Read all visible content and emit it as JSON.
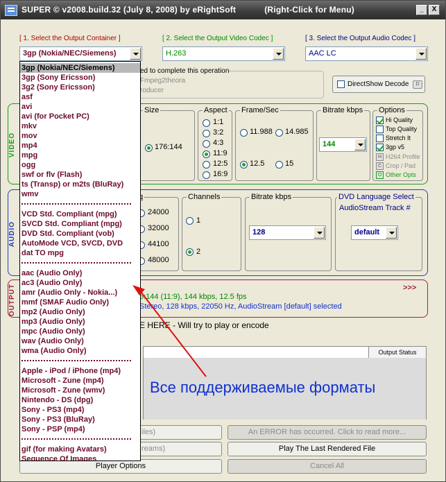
{
  "window": {
    "title": "SUPER © v2008.build.32 (July 8, 2008) by eRightSoft",
    "hint": "(Right-Click for Menu)",
    "minimize_label": "_",
    "close_label": "X"
  },
  "steps": {
    "container": "[ 1.    Select the Output Container ]",
    "video_codec": "[ 2.   Select the Output Video Codec ]",
    "audio_codec": "[ 3.   Select the Output Audio Codec ]"
  },
  "selects": {
    "container": "3gp  (Nokia/NEC/Siemens)",
    "video_codec": "H.263",
    "audio_codec": "AAC LC"
  },
  "encoders": {
    "line1": "ed to complete this operation",
    "line2": "Fmpeg2theora",
    "line3": "roducer"
  },
  "directshow_label": "DirectShow Decode",
  "directshow_key": "D",
  "video": {
    "section_label": "VIDEO",
    "size": {
      "label": "Size",
      "value": "176:144"
    },
    "aspect": {
      "label": "Aspect",
      "options": [
        "1:1",
        "3:2",
        "4:3",
        "11:9",
        "12:5",
        "16:9"
      ],
      "selected": "11:9"
    },
    "framerate": {
      "label": "Frame/Sec",
      "options": [
        "11.988",
        "14.985",
        "12.5",
        "15"
      ],
      "selected": "12.5"
    },
    "bitrate": {
      "label": "Bitrate  kbps",
      "value": "144"
    },
    "options": {
      "label": "Options",
      "items": [
        {
          "label": "Hi Quality",
          "checked": true
        },
        {
          "label": "Top Quality",
          "checked": false
        },
        {
          "label": "Stretch It",
          "checked": false
        },
        {
          "label": "3gp v5",
          "checked": true
        }
      ],
      "h264": "H264 Profile",
      "crop": "Crop / Pad",
      "other": "Other Opts",
      "h_key": "H",
      "c_key": "C",
      "o_key": "O"
    }
  },
  "audio": {
    "section_label": "AUDIO",
    "sampling": {
      "label": "q",
      "options": [
        "24000",
        "32000",
        "44100",
        "48000"
      ]
    },
    "channels": {
      "label": "Channels",
      "options": [
        "1",
        "2"
      ],
      "selected": "2"
    },
    "bitrate": {
      "label": "Bitrate  kbps",
      "value": "128"
    },
    "dvd": {
      "label": "DVD Language Select",
      "label2": "AudioStream  Track #",
      "value": "default"
    }
  },
  "output": {
    "section_label": "OUTPUT",
    "arrows": ">>>",
    "summary_video": "6:144 (11:9),  144 kbps,  12.5 fps",
    "summary_audio": "Stereo,  128 kbps,  22050 Hz,  AudioStream [default] selected"
  },
  "drop_hint": "E HERE - Will try to play or encode",
  "status_header": "Output Status",
  "annotation": "Все поддерживаемые форматы",
  "buttons": {
    "files": "iles)",
    "error": "An ERROR has occurred. Click to read more...",
    "streams": "reams)",
    "play_last": "Play The Last Rendered File",
    "player_options": "Player Options",
    "cancel_all": "Cancel All"
  },
  "dropdown": {
    "groups": [
      [
        "3gp  (Nokia/NEC/Siemens)",
        "3gp  (Sony Ericsson)",
        "3g2  (Sony Ericsson)",
        "asf",
        "avi",
        "avi  (for Pocket PC)",
        "mkv",
        "mov",
        "mp4",
        "mpg",
        "ogg",
        "swf or flv (Flash)",
        "ts (Transp) or m2ts (BluRay)",
        "wmv"
      ],
      [
        "VCD   Std. Compliant (mpg)",
        "SVCD Std. Compliant (mpg)",
        "DVD   Std. Compliant (vob)",
        "AutoMode VCD, SVCD, DVD",
        "dat   TO   mpg"
      ],
      [
        "aac  (Audio Only)",
        "ac3  (Audio Only)",
        "amr  (Audio Only - Nokia...)",
        "mmf  (SMAF Audio Only)",
        "mp2  (Audio Only)",
        "mp3  (Audio Only)",
        "mpc  (Audio Only)",
        "wav  (Audio Only)",
        "wma  (Audio Only)"
      ],
      [
        "Apple - iPod / iPhone (mp4)",
        "Microsoft - Zune (mp4)",
        "Microsoft - Zune (wmv)",
        "Nintendo - DS (dpg)",
        "Sony - PS3  (mp4)",
        "Sony - PS3  (BluRay)",
        "Sony - PSP (mp4)"
      ],
      [
        "gif  (for making Avatars)",
        "Sequence Of Images"
      ]
    ]
  },
  "colors": {
    "video_frame": "#1a9a1a",
    "audio_frame": "#2040c0",
    "output_frame": "#a02040",
    "dropdown_text": "#6c0a2a",
    "annotation": "#1030d0",
    "arrow": "#e01010"
  }
}
